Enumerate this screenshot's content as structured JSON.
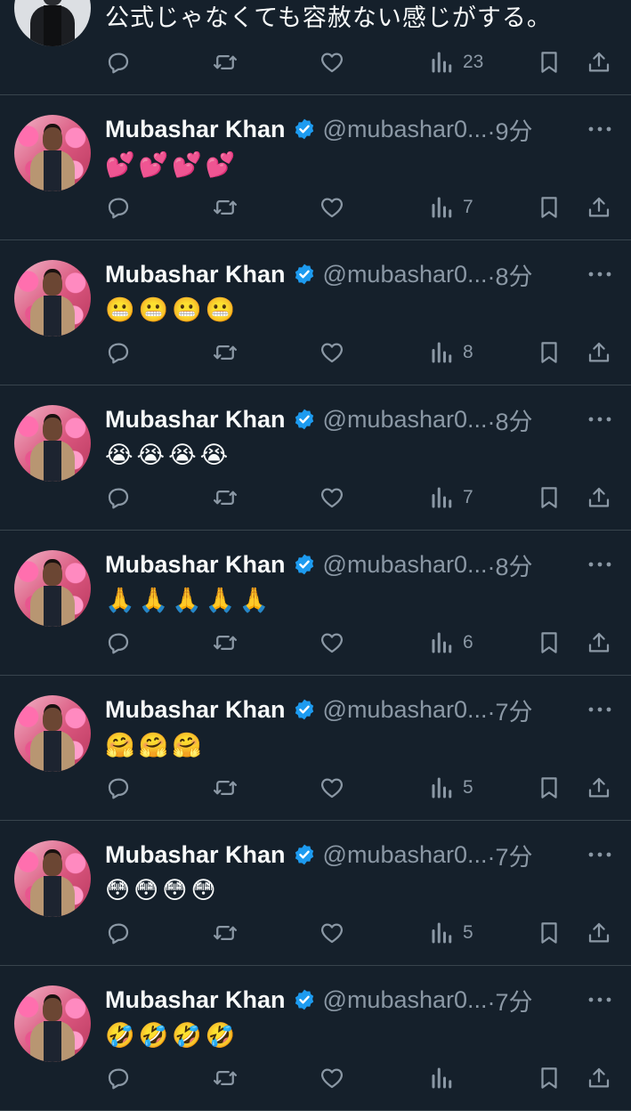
{
  "colors": {
    "background": "#15202b",
    "text": "#f7f9f9",
    "muted": "#8b98a5",
    "verified": "#1d9bf0",
    "divider": "#38444d"
  },
  "icons": {
    "reply": "comment-icon",
    "retweet": "retweet-icon",
    "like": "heart-icon",
    "views": "analytics-icon",
    "bookmark": "bookmark-icon",
    "share": "share-icon",
    "verified": "verified-badge-icon",
    "more": "more-dots-icon"
  },
  "top_tweet": {
    "text": "公式じゃなくても容赦ない感じがする。",
    "views": "23"
  },
  "tweets": [
    {
      "name": "Mubashar Khan",
      "handle": "@mubashar0...",
      "time": "·9分",
      "text": "💕💕💕💕",
      "views": "7"
    },
    {
      "name": "Mubashar Khan",
      "handle": "@mubashar0...",
      "time": "·8分",
      "text": "😬😬😬😬",
      "views": "8"
    },
    {
      "name": "Mubashar Khan",
      "handle": "@mubashar0...",
      "time": "·8分",
      "text": "😭😭😭😭",
      "views": "7"
    },
    {
      "name": "Mubashar Khan",
      "handle": "@mubashar0...",
      "time": "·8分",
      "text": "🙏🙏🙏🙏🙏",
      "views": "6"
    },
    {
      "name": "Mubashar Khan",
      "handle": "@mubashar0...",
      "time": "·7分",
      "text": "🤗🤗🤗",
      "views": "5"
    },
    {
      "name": "Mubashar Khan",
      "handle": "@mubashar0...",
      "time": "·7分",
      "text": "😳😳😳😳",
      "views": "5"
    },
    {
      "name": "Mubashar Khan",
      "handle": "@mubashar0...",
      "time": "·7分",
      "text": "🤣🤣🤣🤣",
      "views": ""
    }
  ]
}
